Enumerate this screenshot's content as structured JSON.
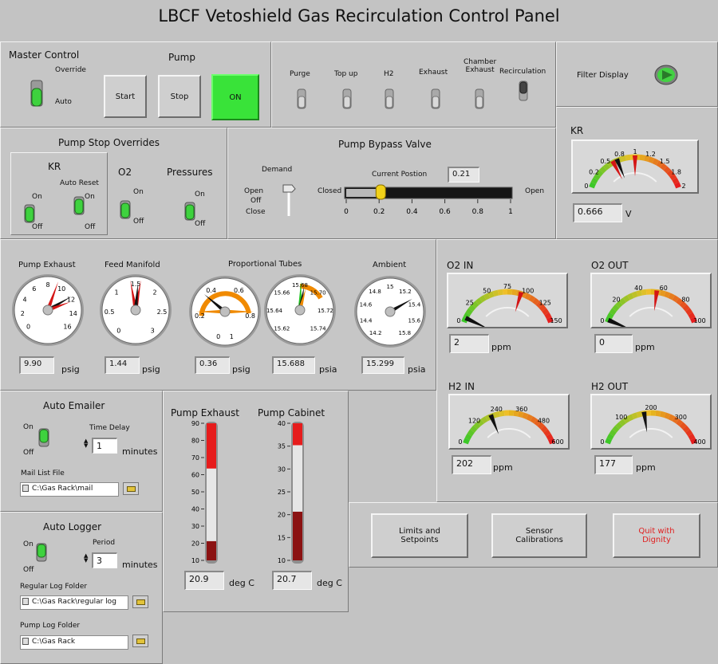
{
  "title": "LBCF Vetoshield Gas Recirculation Control Panel",
  "master": {
    "label": "Master Control",
    "override": "Override",
    "auto": "Auto"
  },
  "pump": {
    "label": "Pump",
    "start": "Start",
    "stop": "Stop",
    "on": "ON"
  },
  "switches": {
    "purge": "Purge",
    "topup": "Top up",
    "h2": "H2",
    "exhaust": "Exhaust",
    "chamber": "Chamber\nExhaust",
    "recirc": "Recirculation"
  },
  "filter": {
    "label": "Filter Display"
  },
  "overrides": {
    "title": "Pump Stop Overrides",
    "kr": "KR",
    "auto_reset": "Auto Reset",
    "o2": "O2",
    "pressures": "Pressures",
    "on": "On",
    "off": "Off"
  },
  "bypass": {
    "title": "Pump Bypass Valve",
    "demand": "Demand",
    "open": "Open",
    "off": "Off",
    "close": "Close",
    "current_label": "Current Postion",
    "current_value": "0.21",
    "closed": "Closed",
    "open_r": "Open",
    "ticks": [
      "0",
      "0.2",
      "0.4",
      "0.6",
      "0.8",
      "1"
    ],
    "position": 0.21
  },
  "kr_meter": {
    "label": "KR",
    "ticks": [
      "0",
      "0.2",
      "0.5",
      "0.8",
      "1",
      "1.2",
      "1.5",
      "1.8",
      "2"
    ],
    "value": "0.666",
    "unit": "V"
  },
  "dials": {
    "pump_exhaust": {
      "label": "Pump Exhaust",
      "value": "9.90",
      "unit": "psig",
      "ticks": [
        "0",
        "2",
        "4",
        "6",
        "8",
        "10",
        "12",
        "14",
        "16"
      ]
    },
    "feed_manifold": {
      "label": "Feed Manifold",
      "value": "1.44",
      "unit": "psig",
      "ticks": [
        "0",
        "0.5",
        "1",
        "1.5",
        "2",
        "2.5",
        "3"
      ]
    },
    "prop_title": "Proportional Tubes",
    "prop1": {
      "value": "0.36",
      "unit": "psig",
      "ticks": [
        "0",
        "0.2",
        "0.4",
        "0.6",
        "0.8",
        "1"
      ]
    },
    "prop2": {
      "value": "15.688",
      "unit": "psia",
      "ticks": [
        "15.62",
        "15.64",
        "15.66",
        "15.68",
        "15.70",
        "15.72",
        "15.74"
      ]
    },
    "ambient": {
      "label": "Ambient",
      "value": "15.299",
      "unit": "psia",
      "ticks": [
        "14.2",
        "14.4",
        "14.6",
        "14.8",
        "15",
        "15.2",
        "15.4",
        "15.6",
        "15.8"
      ]
    }
  },
  "o2_in": {
    "label": "O2 IN",
    "ticks": [
      "0",
      "25",
      "50",
      "75",
      "100",
      "125",
      "150"
    ],
    "value": "2",
    "unit": "ppm"
  },
  "o2_out": {
    "label": "O2 OUT",
    "ticks": [
      "0",
      "20",
      "40",
      "60",
      "80",
      "100"
    ],
    "value": "0",
    "unit": "ppm"
  },
  "h2_in": {
    "label": "H2 IN",
    "ticks": [
      "0",
      "120",
      "240",
      "360",
      "480",
      "600"
    ],
    "value": "202",
    "unit": "ppm"
  },
  "h2_out": {
    "label": "H2 OUT",
    "ticks": [
      "0",
      "100",
      "200",
      "300",
      "400"
    ],
    "value": "177",
    "unit": "ppm"
  },
  "emailer": {
    "title": "Auto Emailer",
    "on": "On",
    "off": "Off",
    "delay_label": "Time Delay",
    "delay_value": "1",
    "minutes": "minutes",
    "mail_label": "Mail List File",
    "mail_path": "C:\\Gas Rack\\mail"
  },
  "logger": {
    "title": "Auto Logger",
    "on": "On",
    "off": "Off",
    "period_label": "Period",
    "period_value": "3",
    "minutes": "minutes",
    "regular_label": "Regular Log Folder",
    "regular_path": "C:\\Gas Rack\\regular log",
    "pump_label": "Pump Log Folder",
    "pump_path": "C:\\Gas Rack"
  },
  "temps": {
    "exhaust": {
      "label": "Pump Exhaust",
      "ticks": [
        "10",
        "20",
        "30",
        "40",
        "50",
        "60",
        "70",
        "80",
        "90"
      ],
      "value": "20.9",
      "unit": "deg C"
    },
    "cabinet": {
      "label": "Pump Cabinet",
      "ticks": [
        "10",
        "15",
        "20",
        "25",
        "30",
        "35",
        "40"
      ],
      "value": "20.7",
      "unit": "deg C"
    }
  },
  "buttons": {
    "limits": "Limits and\nSetpoints",
    "sensor": "Sensor\nCalibrations",
    "quit": "Quit with\nDignity"
  }
}
